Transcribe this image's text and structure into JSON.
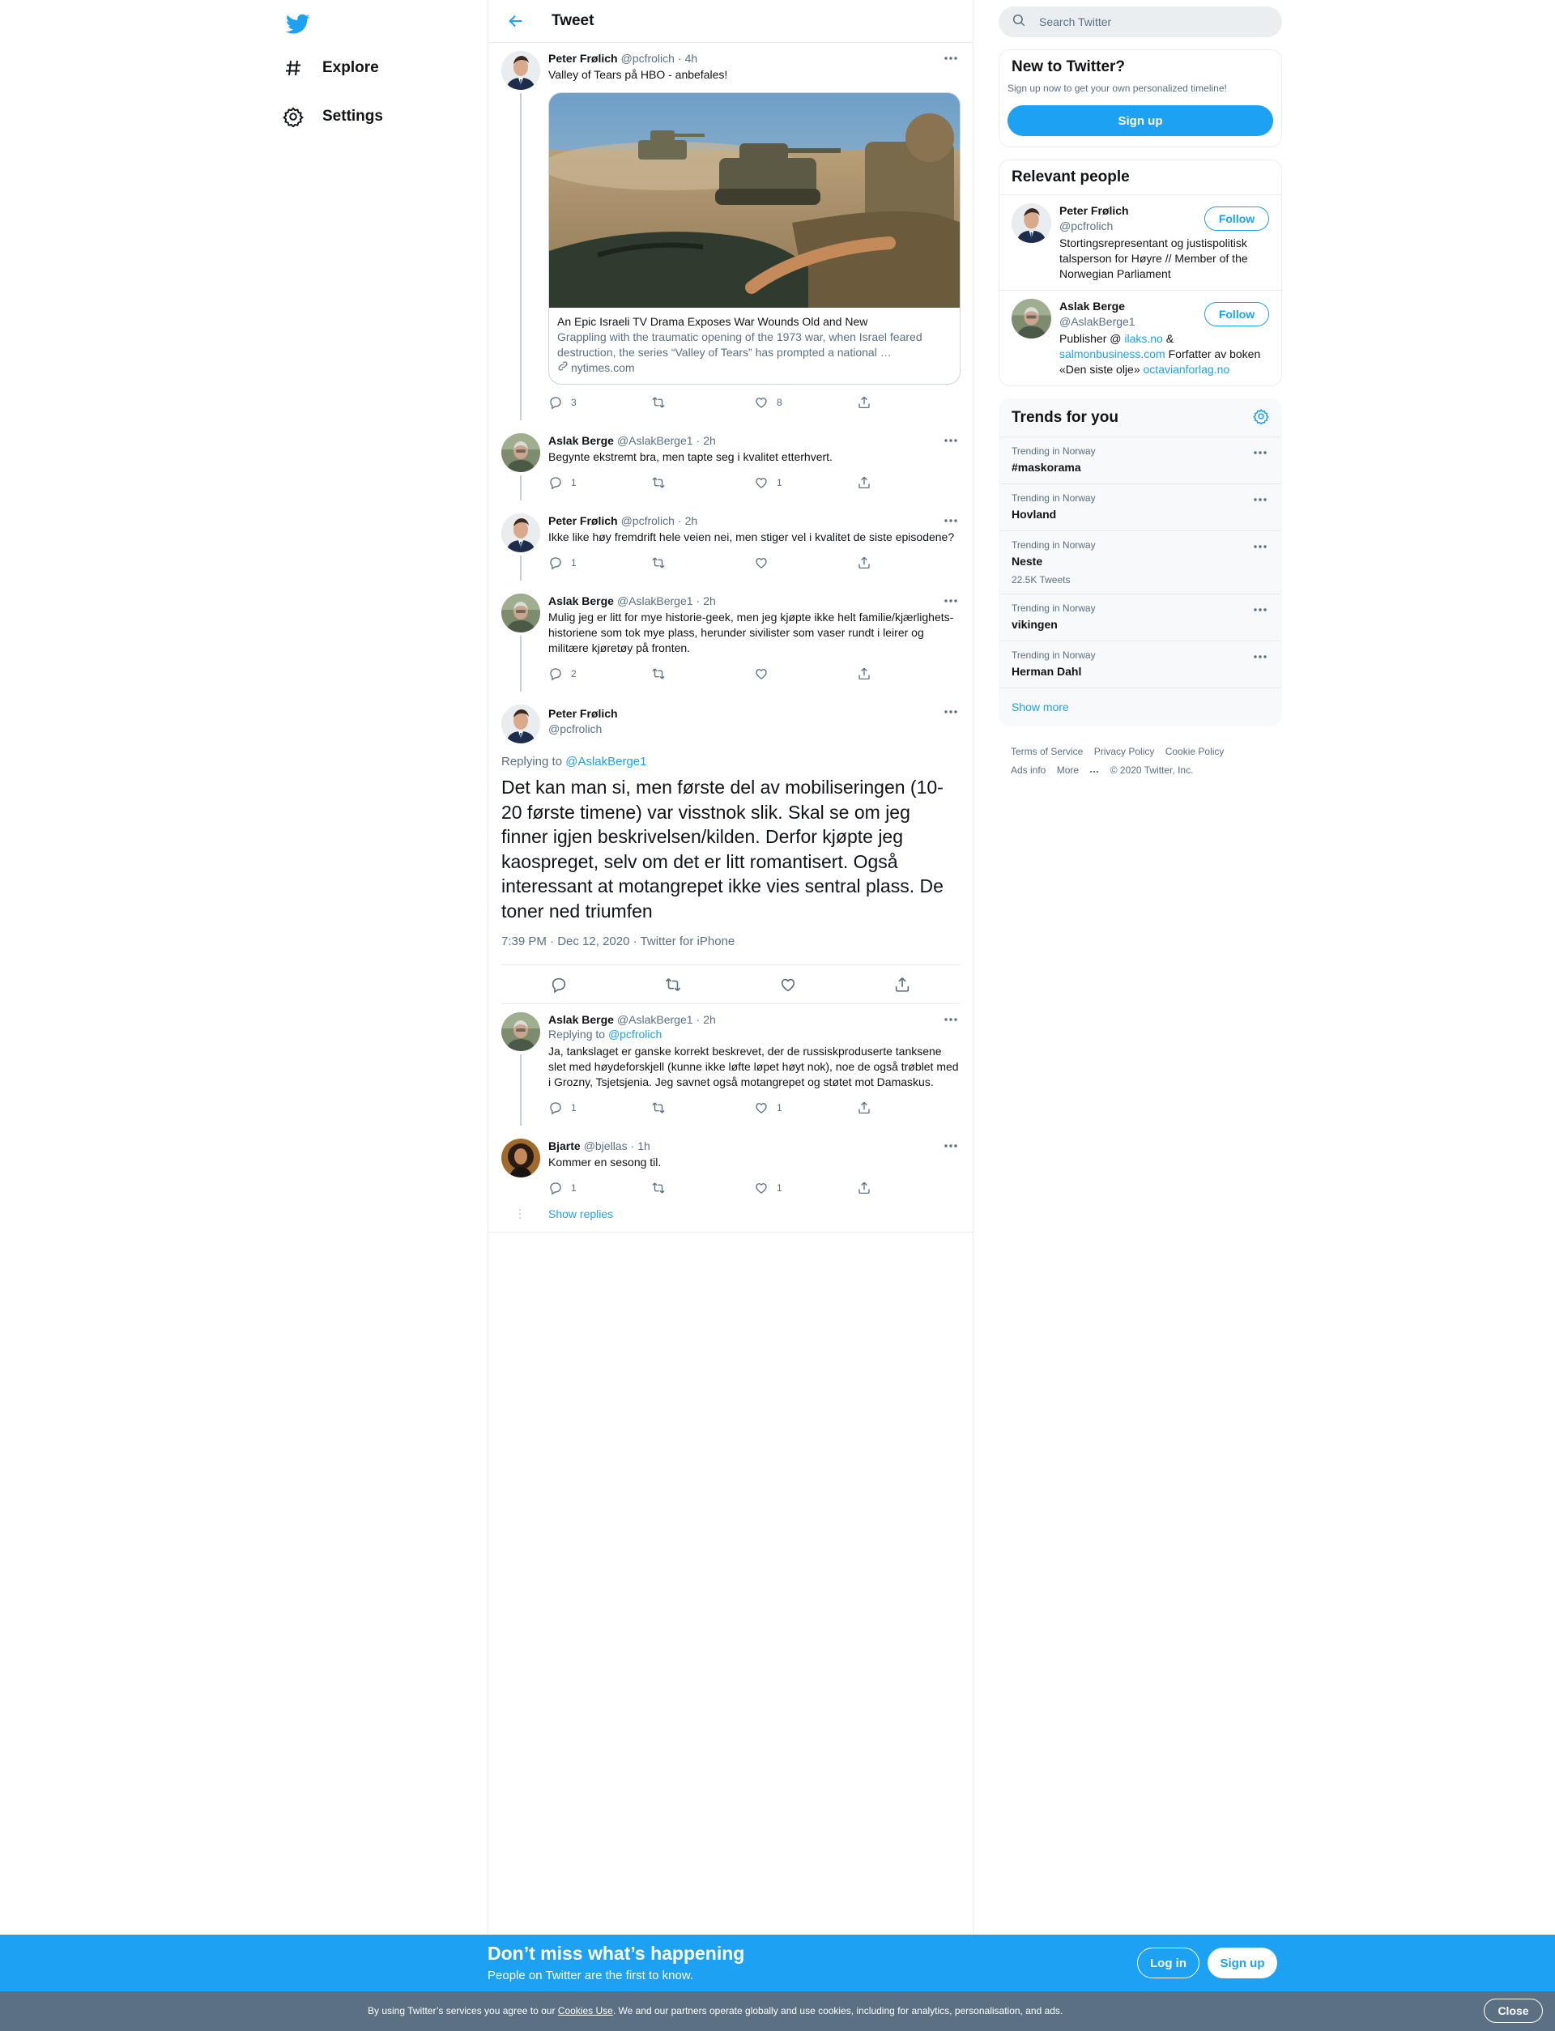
{
  "nav": {
    "logo_icon": "twitter-bird-icon",
    "items": [
      {
        "icon": "hashtag-icon",
        "label": "Explore"
      },
      {
        "icon": "gear-icon",
        "label": "Settings"
      }
    ]
  },
  "header": {
    "back_icon": "arrow-left-icon",
    "title": "Tweet"
  },
  "tweets": [
    {
      "name": "Peter Frølich",
      "handle": "@pcfrolich",
      "time": "4h",
      "text": "Valley of Tears på HBO - anbefales!",
      "card": {
        "title": "An Epic Israeli TV Drama Exposes War Wounds Old and New",
        "desc_line1": "Grappling with the traumatic opening of the 1973 war, when Israel feared",
        "desc_line2": "destruction, the series “Valley of Tears” has prompted a national …",
        "domain": "nytimes.com"
      },
      "replies": "3",
      "retweets": "",
      "likes": "8"
    },
    {
      "name": "Aslak Berge",
      "handle": "@AslakBerge1",
      "time": "2h",
      "text": "Begynte ekstremt bra, men tapte seg i kvalitet etterhvert.",
      "replies": "1",
      "retweets": "",
      "likes": "1"
    },
    {
      "name": "Peter Frølich",
      "handle": "@pcfrolich",
      "time": "2h",
      "text": "Ikke like høy fremdrift hele veien nei, men stiger vel i kvalitet de siste episodene?",
      "replies": "1",
      "retweets": "",
      "likes": ""
    },
    {
      "name": "Aslak Berge",
      "handle": "@AslakBerge1",
      "time": "2h",
      "text": "Mulig jeg er litt for mye historie-geek, men jeg kjøpte ikke helt familie/kjærlighets-historiene som tok mye plass, herunder sivilister som vaser rundt i leirer og militære kjøretøy på fronten.",
      "replies": "2",
      "retweets": "",
      "likes": ""
    }
  ],
  "focus": {
    "name": "Peter Frølich",
    "handle": "@pcfrolich",
    "replying_prefix": "Replying to",
    "replying_to": "@AslakBerge1",
    "text": "Det kan man si, men første del av mobiliseringen (10-20 første timene) var visstnok slik. Skal se om jeg finner igjen beskrivelsen/kilden. Derfor kjøpte jeg kaospreget, selv om det er litt romantisert. Også interessant at motangrepet ikke vies sentral plass. De toner ned triumfen",
    "time": "7:39 PM",
    "date": "Dec 12, 2020",
    "source": "Twitter for iPhone"
  },
  "replies": [
    {
      "name": "Aslak Berge",
      "handle": "@AslakBerge1",
      "time": "2h",
      "replying_prefix": "Replying to",
      "replying_to": "@pcfrolich",
      "text": "Ja, tankslaget er ganske korrekt beskrevet, der de russiskproduserte tanksene slet med høydeforskjell (kunne ikke løfte løpet høyt nok), noe de også trøblet med i Grozny, Tsjetsjenia. Jeg savnet også motangrepet og støtet mot Damaskus.",
      "replies": "1",
      "retweets": "",
      "likes": "1"
    },
    {
      "name": "Bjarte",
      "handle": "@bjellas",
      "time": "1h",
      "text": "Kommer en sesong til.",
      "replies": "1",
      "retweets": "",
      "likes": "1"
    }
  ],
  "show_replies": "Show replies",
  "search": {
    "placeholder": "Search Twitter"
  },
  "new_to_twitter": {
    "title": "New to Twitter?",
    "subtitle": "Sign up now to get your own personalized timeline!",
    "button": "Sign up"
  },
  "relevant_people": {
    "title": "Relevant people",
    "follow_label": "Follow",
    "people": [
      {
        "name": "Peter Frølich",
        "handle": "@pcfrolich",
        "bio": "Stortingsrepresentant og justispolitisk talsperson for Høyre // Member of the Norwegian Parliament"
      },
      {
        "name": "Aslak Berge",
        "handle": "@AslakBerge1",
        "bio_1": "Publisher @ ",
        "link_1": "ilaks.no",
        "bio_2": " & ",
        "link_2": "salmonbusiness.com",
        "bio_3": " Forfatter av boken «Den siste olje» ",
        "link_3": "octavianforlag.no"
      }
    ]
  },
  "trends": {
    "title": "Trends for you",
    "items": [
      {
        "context": "Trending in Norway",
        "name": "#maskorama",
        "count": ""
      },
      {
        "context": "Trending in Norway",
        "name": "Hovland",
        "count": ""
      },
      {
        "context": "Trending in Norway",
        "name": "Neste",
        "count": "22.5K Tweets"
      },
      {
        "context": "Trending in Norway",
        "name": "vikingen",
        "count": ""
      },
      {
        "context": "Trending in Norway",
        "name": "Herman Dahl",
        "count": ""
      }
    ],
    "show_more": "Show more"
  },
  "footer": {
    "links": [
      "Terms of Service",
      "Privacy Policy",
      "Cookie Policy",
      "Ads info",
      "More"
    ],
    "copyright": "© 2020 Twitter, Inc."
  },
  "bottom_bar": {
    "title": "Don’t miss what’s happening",
    "subtitle": "People on Twitter are the first to know.",
    "login": "Log in",
    "signup": "Sign up"
  },
  "cookie": {
    "text_1": "By using Twitter’s services you agree to our ",
    "link": "Cookies Use",
    "text_2": ". We and our partners operate globally and use cookies, including for analytics, personalisation, and ads.",
    "close": "Close"
  },
  "colors": {
    "accent": "#1da1f2",
    "secondary_text": "#5b7083",
    "cookie_bar": "#5b7083"
  }
}
